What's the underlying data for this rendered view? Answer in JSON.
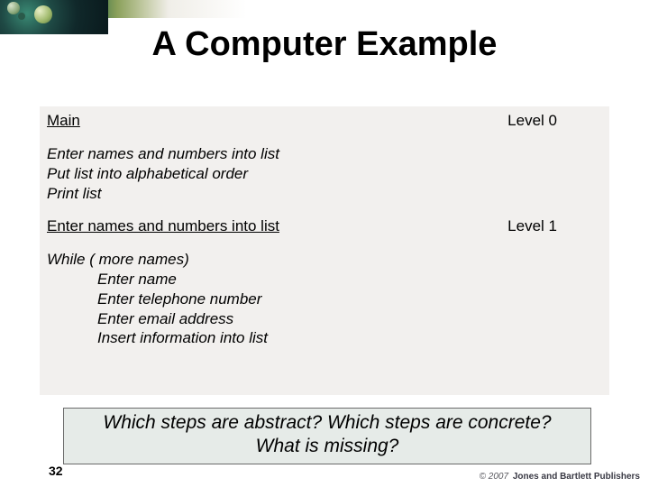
{
  "title": "A Computer Example",
  "section0": {
    "heading": "Main",
    "level": "Level 0",
    "lines": [
      "Enter names and numbers into list",
      "Put list into alphabetical order",
      "Print list"
    ]
  },
  "section1": {
    "heading": "Enter names and numbers into list",
    "level": "Level 1",
    "while_line": "While ( more names)",
    "steps": [
      "Enter name",
      "Enter telephone number",
      "Enter email address",
      "Insert information into list"
    ]
  },
  "question": {
    "l1": "Which steps are abstract? Which steps are concrete?",
    "l2": "What is missing?"
  },
  "page_number": "32",
  "copyright": {
    "year": "© 2007",
    "publisher": "Jones and Bartlett Publishers"
  }
}
